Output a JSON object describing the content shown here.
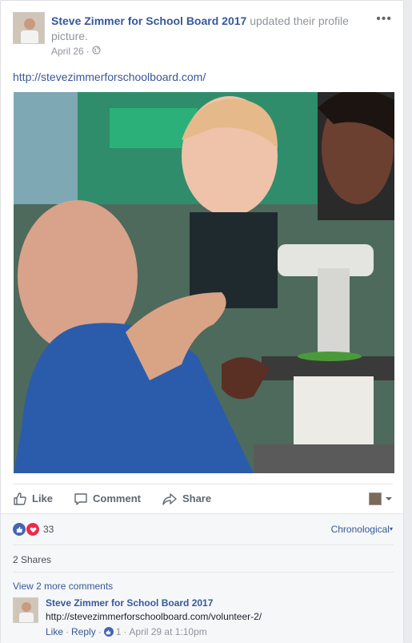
{
  "post": {
    "author_name": "Steve Zimmer for School Board 2017",
    "action_text": " updated their profile picture.",
    "date": "April 26",
    "separator": "·",
    "privacy_icon": "globe-icon",
    "menu_icon": "ellipsis-icon",
    "body_link": "http://stevezimmerforschoolboard.com/"
  },
  "actions": {
    "like_label": "Like",
    "comment_label": "Comment",
    "share_label": "Share",
    "viewer_icon": "viewer-avatar"
  },
  "feedback": {
    "reaction_count": "33",
    "reaction_icons": [
      "like-reaction-icon",
      "love-reaction-icon"
    ],
    "sort_label": "Chronological",
    "shares_label": "2 Shares",
    "view_more_label": "View 2 more comments"
  },
  "comment": {
    "author": "Steve Zimmer for School Board 2017",
    "text": "http://stevezimmerforschoolboard.com/volunteer-2/",
    "like_label": "Like",
    "reply_label": "Reply",
    "separator": "·",
    "like_count": "1",
    "timestamp": "April 29 at 1:10pm"
  },
  "colors": {
    "link": "#365899",
    "meta": "#90949c",
    "like_blue": "#4267b2",
    "love_red": "#f0284a",
    "photo_shirt_blue": "#2b5cab"
  }
}
